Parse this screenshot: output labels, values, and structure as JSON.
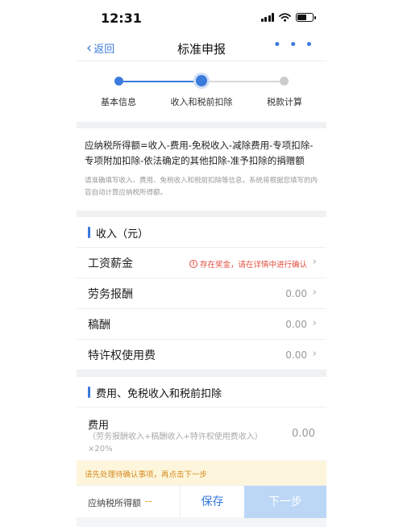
{
  "status_bar": {
    "time": "12:31",
    "battery_level": 0.6
  },
  "nav": {
    "back_label": "返回",
    "title": "标准申报",
    "more_label": "• • •"
  },
  "stepper": {
    "steps": [
      {
        "label": "基本信息",
        "state": "done"
      },
      {
        "label": "收入和税前扣除",
        "state": "active"
      },
      {
        "label": "税款计算",
        "state": "todo"
      }
    ]
  },
  "info": {
    "formula": "应纳税所得额=收入-费用-免税收入-减除费用-专项扣除-专项附加扣除-依法确定的其他扣除-准予扣除的捐赠额",
    "hint": "请准确填写收入、费用、免税收入和税前扣除等信息，系统将根据您填写的内容自动计算应纳税所得额。"
  },
  "income": {
    "title": "收入（元）",
    "rows": [
      {
        "label": "工资薪金",
        "warning": "存在奖金，请在详情中进行确认",
        "warning_icon": "!"
      },
      {
        "label": "劳务报酬",
        "value": "0.00"
      },
      {
        "label": "稿酬",
        "value": "0.00"
      },
      {
        "label": "特许权使用费",
        "value": "0.00"
      }
    ]
  },
  "deductions": {
    "title": "费用、免税收入和税前扣除",
    "fee": {
      "label": "费用",
      "formula": "（劳务报酬收入+稿酬收入+特许权使用费收入）×20%",
      "value": "0.00"
    }
  },
  "notice": "请先处理待确认事项，再点击下一步",
  "bottom": {
    "taxable_label": "应纳税所得额",
    "taxable_value": "--",
    "save_label": "保存",
    "next_label": "下一步"
  },
  "colors": {
    "accent": "#3a7bdc",
    "warning": "#e04b3c",
    "notice_bg": "#fef6dc",
    "disabled_button": "#bcd6f6"
  },
  "icons": {
    "back": "chevron-left-icon",
    "more": "more-dots-icon",
    "row_arrow": "chevron-right-icon",
    "warning": "alert-circle-icon"
  }
}
